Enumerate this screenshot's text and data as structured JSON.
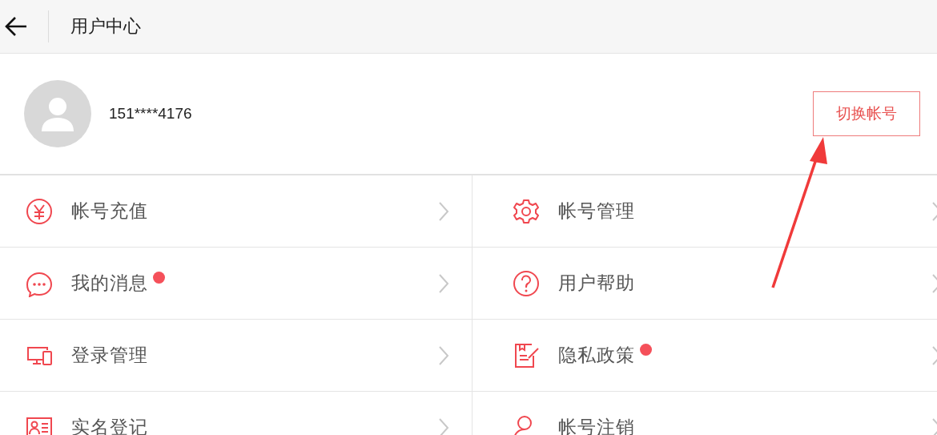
{
  "header": {
    "title": "用户中心"
  },
  "profile": {
    "phone": "151****4176",
    "switch_button": "切换帐号"
  },
  "menu": [
    {
      "label": "帐号充值",
      "unread": false
    },
    {
      "label": "帐号管理",
      "unread": false
    },
    {
      "label": "我的消息",
      "unread": true
    },
    {
      "label": "用户帮助",
      "unread": false
    },
    {
      "label": "登录管理",
      "unread": false
    },
    {
      "label": "隐私政策",
      "unread": true
    },
    {
      "label": "实名登记",
      "unread": false
    },
    {
      "label": "帐号注销",
      "unread": false
    }
  ]
}
